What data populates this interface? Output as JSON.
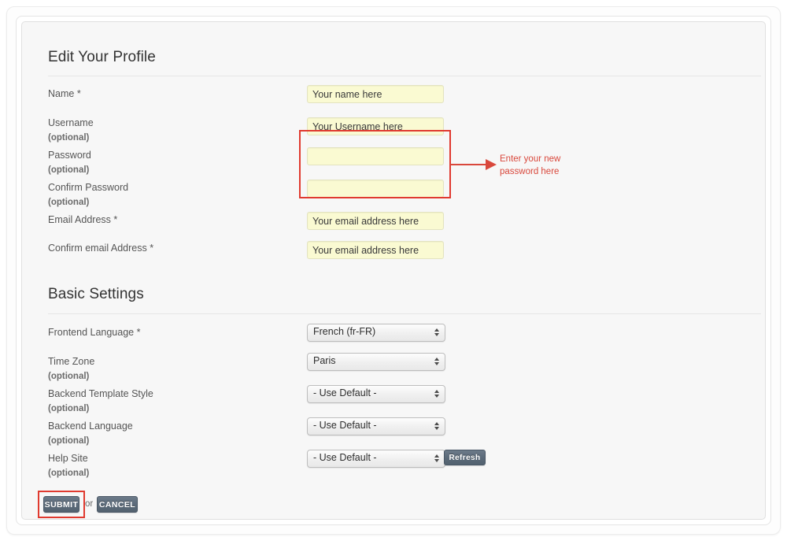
{
  "page": {
    "profile_section_title": "Edit Your Profile",
    "settings_section_title": "Basic Settings"
  },
  "profile_fields": [
    {
      "label": "Name *",
      "optional": "",
      "input_name": "name-input",
      "placeholder": "Your name here",
      "value": ""
    },
    {
      "label": "Username",
      "optional": "(optional)",
      "input_name": "username-input",
      "placeholder": "Your Username here",
      "value": ""
    },
    {
      "label": "Password",
      "optional": "(optional)",
      "input_name": "password-input",
      "placeholder": "",
      "value": ""
    },
    {
      "label": "Confirm Password",
      "optional": "(optional)",
      "input_name": "confirm-password-input",
      "placeholder": "",
      "value": ""
    },
    {
      "label": "Email Address *",
      "optional": "",
      "input_name": "email-address-input",
      "placeholder": "Your email address here",
      "value": ""
    },
    {
      "label": "Confirm email Address *",
      "optional": "",
      "input_name": "confirm-email-address-input",
      "placeholder": "Your email address here",
      "value": ""
    }
  ],
  "settings_fields": [
    {
      "label": "Frontend Language *",
      "optional": "",
      "select_name": "frontend-language-select",
      "selected": "French (fr-FR)"
    },
    {
      "label": "Time Zone",
      "optional": "(optional)",
      "select_name": "time-zone-select",
      "selected": "Paris"
    },
    {
      "label": "Backend Template Style",
      "optional": "(optional)",
      "select_name": "backend-template-style-select",
      "selected": "- Use Default -"
    },
    {
      "label": "Backend Language",
      "optional": "(optional)",
      "select_name": "backend-language-select",
      "selected": "- Use Default -"
    },
    {
      "label": "Help Site",
      "optional": "(optional)",
      "select_name": "help-site-select",
      "selected": "- Use Default -"
    }
  ],
  "actions": {
    "refresh_label": "Refresh",
    "submit_label": "SUBMIT",
    "or_label": "or",
    "cancel_label": "CANCEL"
  },
  "annotations": {
    "password_callout_line1": "Enter your new",
    "password_callout_line2": "password here",
    "callout_color": "#d9483c",
    "highlight_color": "#e03a2f"
  },
  "colors": {
    "input_background": "#fafad2",
    "panel_background": "#f7f7f7",
    "button_slate": "#5c6b7a",
    "heading_text": "#333333",
    "label_text": "#555555"
  }
}
